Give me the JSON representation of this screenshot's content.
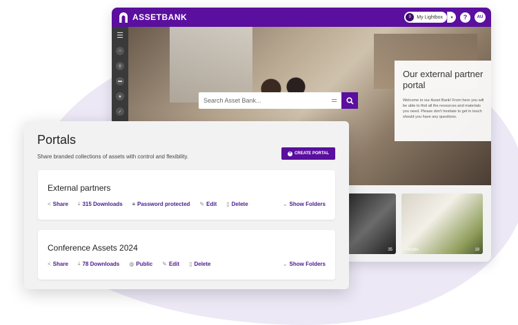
{
  "app": {
    "brand": "ASSETBANK",
    "lightbox_count": "0",
    "lightbox_label": "My Lightbox",
    "help_label": "?",
    "user_initials": "AU"
  },
  "search": {
    "placeholder": "Search Asset Bank..."
  },
  "promo": {
    "title": "Our external partner portal",
    "text": "Welcome to our Asset Bank! From here you will be able to find all the resources and materials you need. Please don't hesitate to get in touch should you have any questions."
  },
  "tiles": [
    {
      "label": "",
      "count": "35"
    },
    {
      "label": "People",
      "count": "18"
    }
  ],
  "portals_page": {
    "title": "Portals",
    "subtitle": "Share branded collections of assets with control and flexibility.",
    "create_label": "CREATE PORTAL",
    "items": [
      {
        "name": "External partners",
        "share": "Share",
        "downloads": "315 Downloads",
        "access": "Password protected",
        "edit": "Edit",
        "delete": "Delete",
        "folders": "Show Folders"
      },
      {
        "name": "Conference Assets 2024",
        "share": "Share",
        "downloads": "78 Downloads",
        "access": "Public",
        "edit": "Edit",
        "delete": "Delete",
        "folders": "Show Folders"
      }
    ]
  },
  "colors": {
    "accent": "#5a0f9e",
    "link": "#4a1a8c"
  }
}
